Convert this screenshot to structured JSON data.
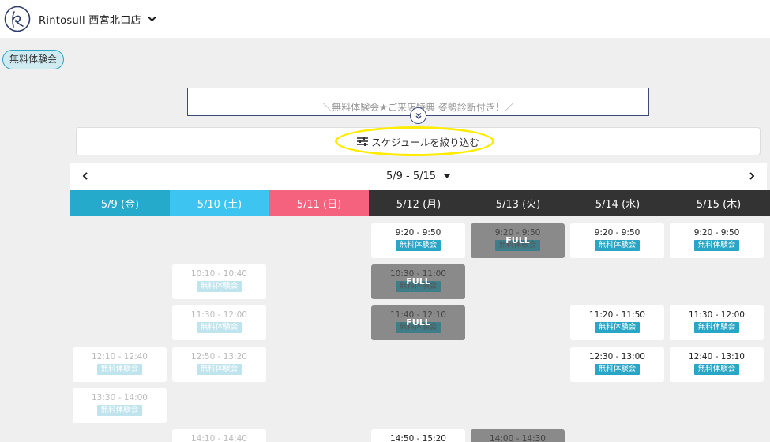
{
  "header": {
    "store_name": "Rintosull 西宮北口店"
  },
  "tag": {
    "label": "無料体験会"
  },
  "banner": {
    "text": "＼無料体験会★ご来店特典 姿勢診断付き！／"
  },
  "filter": {
    "label": "スケジュールを絞り込む"
  },
  "week": {
    "label": "5/9 - 5/15"
  },
  "colors": {
    "fri": "#25aacb",
    "sat": "#3ec4f0",
    "sun": "#f5627e",
    "weekday": "#333333",
    "accent": "#29a6c6",
    "full": "#8a8a8a",
    "highlight": "#ffec00"
  },
  "days": [
    {
      "label": "5/9 (金)"
    },
    {
      "label": "5/10 (土)"
    },
    {
      "label": "5/11 (日)"
    },
    {
      "label": "5/12 (月)"
    },
    {
      "label": "5/13 (火)"
    },
    {
      "label": "5/14 (水)"
    },
    {
      "label": "5/15 (木)"
    }
  ],
  "slot_badge": "無料体験会",
  "full_label": "FULL",
  "slots": [
    {
      "day": 3,
      "row": 0,
      "time": "9:20 - 9:50",
      "state": "open"
    },
    {
      "day": 4,
      "row": 0,
      "time": "9:20 - 9:50",
      "state": "full"
    },
    {
      "day": 5,
      "row": 0,
      "time": "9:20 - 9:50",
      "state": "open"
    },
    {
      "day": 6,
      "row": 0,
      "time": "9:20 - 9:50",
      "state": "open"
    },
    {
      "day": 1,
      "row": 1,
      "time": "10:10 - 10:40",
      "state": "past"
    },
    {
      "day": 3,
      "row": 1,
      "time": "10:30 - 11:00",
      "state": "full"
    },
    {
      "day": 1,
      "row": 2,
      "time": "11:30 - 12:00",
      "state": "past"
    },
    {
      "day": 3,
      "row": 2,
      "time": "11:40 - 12:10",
      "state": "full"
    },
    {
      "day": 5,
      "row": 2,
      "time": "11:20 - 11:50",
      "state": "open"
    },
    {
      "day": 6,
      "row": 2,
      "time": "11:30 - 12:00",
      "state": "open"
    },
    {
      "day": 0,
      "row": 3,
      "time": "12:10 - 12:40",
      "state": "past"
    },
    {
      "day": 1,
      "row": 3,
      "time": "12:50 - 13:20",
      "state": "past"
    },
    {
      "day": 5,
      "row": 3,
      "time": "12:30 - 13:00",
      "state": "open"
    },
    {
      "day": 6,
      "row": 3,
      "time": "12:40 - 13:10",
      "state": "open"
    },
    {
      "day": 0,
      "row": 4,
      "time": "13:30 - 14:00",
      "state": "past"
    },
    {
      "day": 1,
      "row": 5,
      "time": "14:10 - 14:40",
      "state": "past"
    },
    {
      "day": 3,
      "row": 5,
      "time": "14:50 - 15:20",
      "state": "open"
    },
    {
      "day": 4,
      "row": 5,
      "time": "14:00 - 14:30",
      "state": "full"
    }
  ]
}
